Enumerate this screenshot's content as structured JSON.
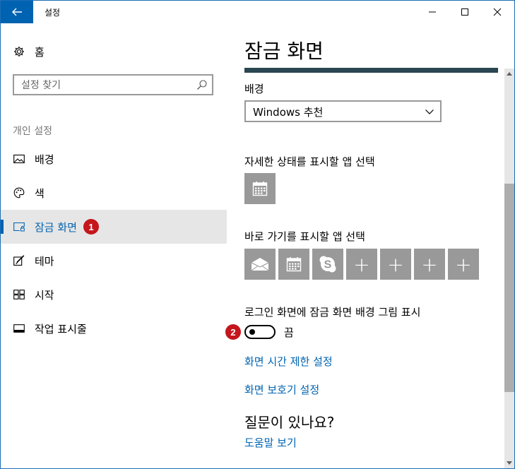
{
  "window": {
    "title": "설정",
    "back_glyph": "←",
    "minimize_glyph": "—",
    "maximize_glyph": "☐",
    "close_glyph": "✕"
  },
  "sidebar": {
    "home_label": "홈",
    "search_placeholder": "설정 찾기",
    "section_caption": "개인 설정",
    "items": [
      {
        "label": "배경",
        "icon": "image-icon"
      },
      {
        "label": "색",
        "icon": "palette-icon"
      },
      {
        "label": "잠금 화면",
        "icon": "lock-screen-icon",
        "active": true
      },
      {
        "label": "테마",
        "icon": "theme-brush-icon"
      },
      {
        "label": "시작",
        "icon": "start-grid-icon"
      },
      {
        "label": "작업 표시줄",
        "icon": "taskbar-icon"
      }
    ],
    "callout_1": "1"
  },
  "main": {
    "page_title": "잠금 화면",
    "background_label": "배경",
    "background_value": "Windows 추천",
    "detailed_status_label": "자세한 상태를 표시할 앱 선택",
    "quick_status_label": "바로 가기를 표시할 앱 선택",
    "quick_tiles": [
      "mail-icon",
      "calendar-icon",
      "skype-icon",
      "plus",
      "plus",
      "plus",
      "plus"
    ],
    "plus_glyph": "+",
    "signin_bg_label": "로그인 화면에 잠금 화면 배경 그림 표시",
    "toggle_state": "끔",
    "toggle_on": false,
    "callout_2": "2",
    "link_timeout": "화면 시간 제한 설정",
    "link_screensaver": "화면 보호기 설정",
    "question_heading": "질문이 있나요?",
    "link_help": "도움말 보기"
  },
  "colors": {
    "accent": "#0063b1",
    "callout": "#c4161c",
    "tile": "#999999"
  }
}
